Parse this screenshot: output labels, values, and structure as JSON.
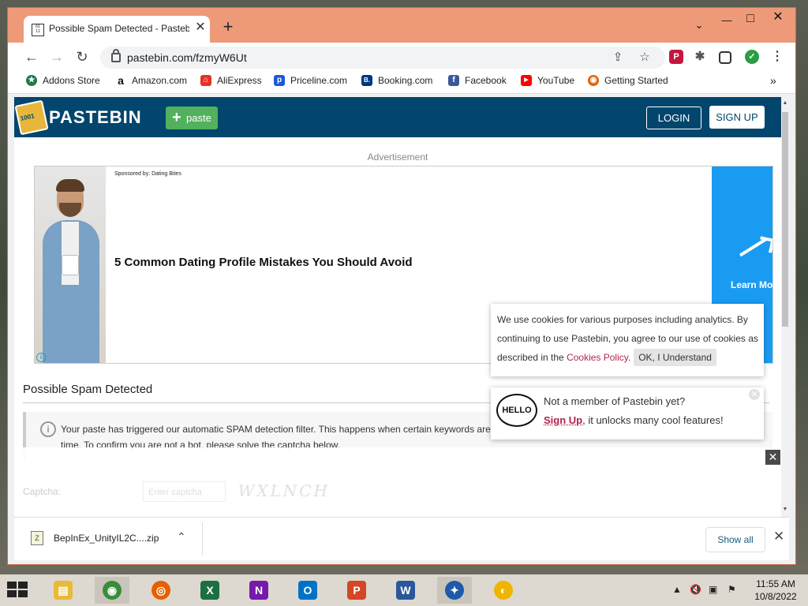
{
  "browser": {
    "tab_title": "Possible Spam Detected - Pastebin.com",
    "tab_favicon_text": "001\n110",
    "new_tab": "+",
    "url": "pastebin.com/fzmyW6Ut",
    "window_controls": {
      "minimize": "—",
      "maximize": "□",
      "close": "✕"
    }
  },
  "bookmarks": [
    {
      "label": "Addons Store",
      "icon_color": "#1f7a4a",
      "icon_char": "★"
    },
    {
      "label": "Amazon.com",
      "icon_color": "#111111",
      "icon_char": "a"
    },
    {
      "label": "AliExpress",
      "icon_color": "#e43225",
      "icon_char": "⌂"
    },
    {
      "label": "Priceline.com",
      "icon_color": "#1a5bd6",
      "icon_char": "p"
    },
    {
      "label": "Booking.com",
      "icon_color": "#003580",
      "icon_char": "B."
    },
    {
      "label": "Facebook",
      "icon_color": "#3b5998",
      "icon_char": "f"
    },
    {
      "label": "YouTube",
      "icon_color": "#ff0000",
      "icon_char": "▶"
    },
    {
      "label": "Getting Started",
      "icon_color": "#e66000",
      "icon_char": "◉"
    }
  ],
  "pastebin": {
    "logo_text": "PASTEBIN",
    "logo_badge": "1001",
    "paste_button": "paste",
    "login": "LOGIN",
    "signup": "SIGN UP"
  },
  "ad": {
    "label": "Advertisement",
    "sponsor": "Sponsored by: Dating Bites",
    "headline": "5 Common Dating Profile Mistakes You Should Avoid",
    "cta": "Learn Mo",
    "info": "i"
  },
  "main": {
    "title": "Possible Spam Detected",
    "alert_text": "Your paste has triggered our automatic SPAM detection filter. This happens when certain keywords are used or when you are creating a lot of pastes in a short period of time. To confirm you are not a bot, please solve the captcha below.",
    "captcha_label": "Captcha:",
    "captcha_placeholder": "Enter captcha",
    "captcha_text": "WXLNCH"
  },
  "cookie": {
    "text_pre": "We use cookies for various purposes including analytics. By continuing to use Pastebin, you agree to our use of cookies as described in the ",
    "link": "Cookies Policy",
    "text_post": ".",
    "button": "OK, I Understand"
  },
  "member": {
    "hello": "HELLO",
    "question": "Not a member of Pastebin yet?",
    "signup": "Sign Up",
    "rest": ", it unlocks many cool features!"
  },
  "download": {
    "filename": "BepInEx_UnityIL2C....zip",
    "show_all": "Show all"
  },
  "taskbar": {
    "apps": [
      {
        "name": "File Explorer",
        "color": "#e8b93a",
        "char": "▤"
      },
      {
        "name": "Chrome",
        "color": "#3a8d3a",
        "char": "◉"
      },
      {
        "name": "Firefox",
        "color": "#e66000",
        "char": "◎"
      },
      {
        "name": "Excel",
        "color": "#1d6f42",
        "char": "X"
      },
      {
        "name": "OneNote",
        "color": "#7719aa",
        "char": "N"
      },
      {
        "name": "Outlook",
        "color": "#0072c6",
        "char": "O"
      },
      {
        "name": "PowerPoint",
        "color": "#d24726",
        "char": "P"
      },
      {
        "name": "Word",
        "color": "#2b579a",
        "char": "W"
      },
      {
        "name": "App",
        "color": "#1e5aa8",
        "char": "✦"
      },
      {
        "name": "App2",
        "color": "#f0b400",
        "char": "◐"
      }
    ],
    "time": "11:55 AM",
    "date": "10/8/2022"
  }
}
